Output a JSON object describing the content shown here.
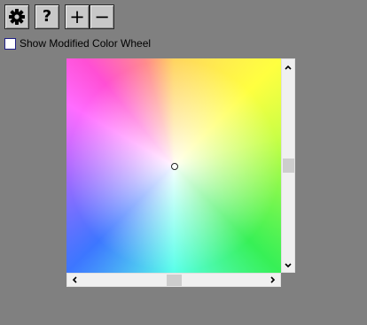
{
  "toolbar": {
    "settings_icon": "gear-icon",
    "help_label": "?",
    "zoom_in_label": "+",
    "zoom_out_label": "−"
  },
  "options": {
    "modified_wheel_label": "Show Modified Color Wheel",
    "modified_wheel_checked": false
  },
  "colors": {
    "background": "#808080",
    "button_face": "#c8c8c8",
    "scrollbar_track": "#f0f0f0",
    "scrollbar_thumb": "#cdcdcd"
  },
  "scroll": {
    "vertical_position": 0.5,
    "horizontal_position": 0.5
  }
}
